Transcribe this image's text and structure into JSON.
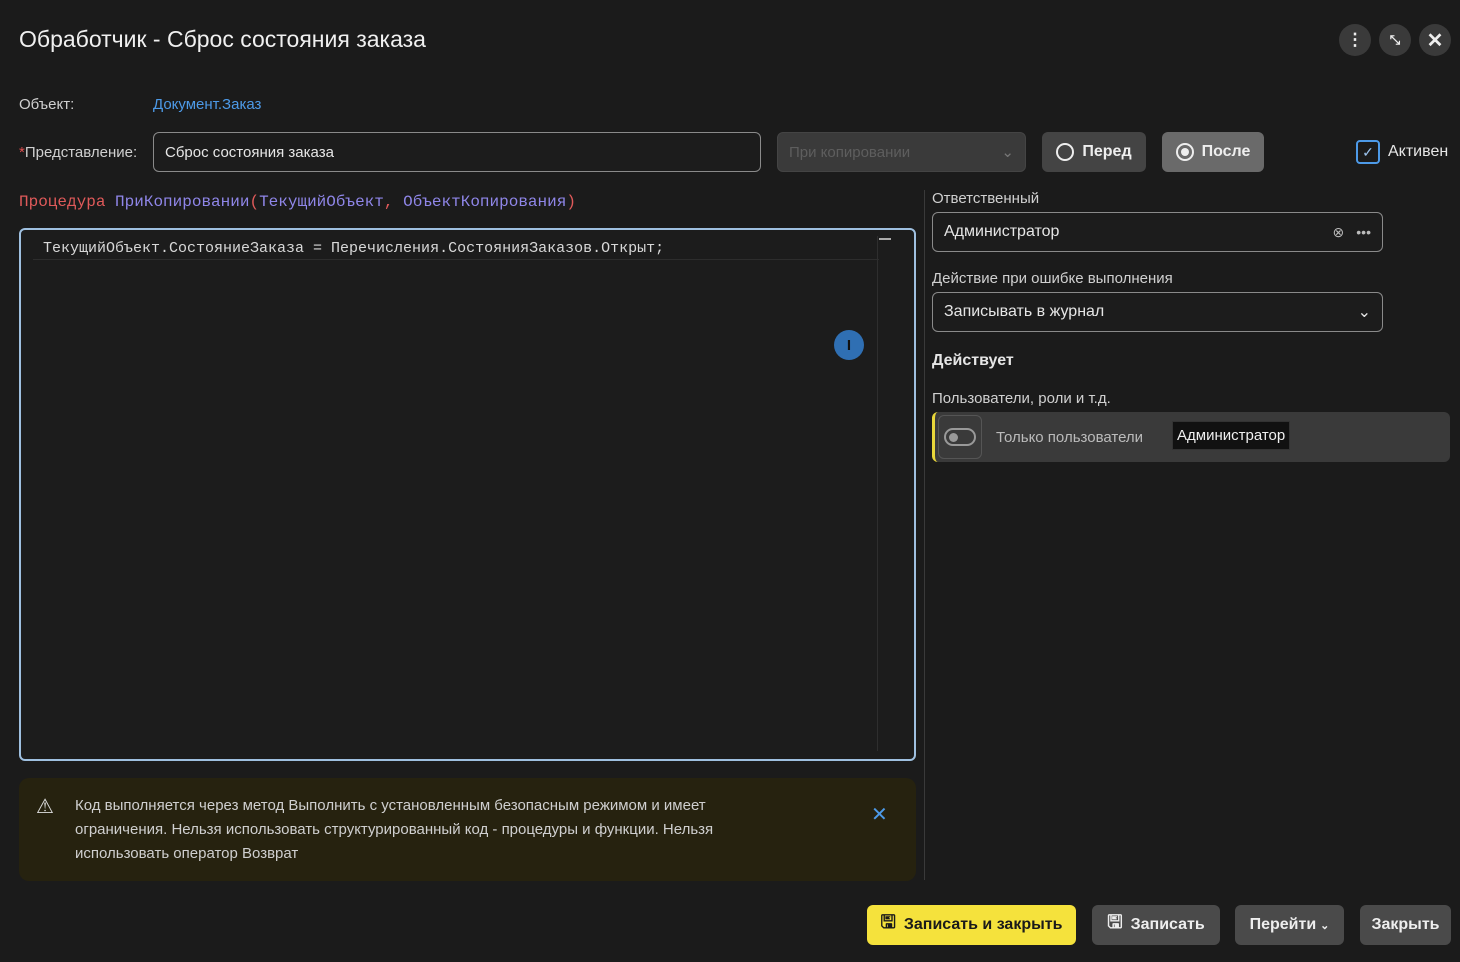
{
  "title": "Обработчик - Сброс состояния заказа",
  "object": {
    "label": "Объект:",
    "value": "Документ.Заказ"
  },
  "presentation": {
    "required_mark": "*",
    "label": "Представление:",
    "value": "Сброс состояния заказа"
  },
  "event_select": {
    "placeholder": "При копировании"
  },
  "timing": {
    "before": "Перед",
    "after": "После",
    "selected": "after"
  },
  "active": {
    "label": "Активен",
    "checked": true
  },
  "code": {
    "kw": "Процедура",
    "name": "ПриКопировании",
    "open": "(",
    "p1": "ТекущийОбъект",
    "comma": ",",
    "p2": "ОбъектКопирования",
    "close": ")",
    "line1": "ТекущийОбъект.СостояниеЗаказа = Перечисления.СостоянияЗаказов.Открыт;"
  },
  "responsible": {
    "label": "Ответственный",
    "value": "Администратор"
  },
  "error_action": {
    "label": "Действие при ошибке выполнения",
    "value": "Записывать в журнал"
  },
  "applies": {
    "heading": "Действует",
    "label": "Пользователи, роли и т.д.",
    "toggle_label": "Только пользователи",
    "tag": "Администратор"
  },
  "warning": {
    "text": "Код выполняется через метод Выполнить с установленным безопасным режимом и имеет ограничения. Нельзя использовать структурированный код - процедуры и функции. Нельзя использовать оператор Возврат"
  },
  "footer": {
    "save_close": "Записать и закрыть",
    "save": "Записать",
    "goto": "Перейти",
    "close": "Закрыть"
  },
  "colors": {
    "accent": "#f5e23c",
    "link": "#4d9ae8",
    "editor_border": "#9fc0e0"
  }
}
